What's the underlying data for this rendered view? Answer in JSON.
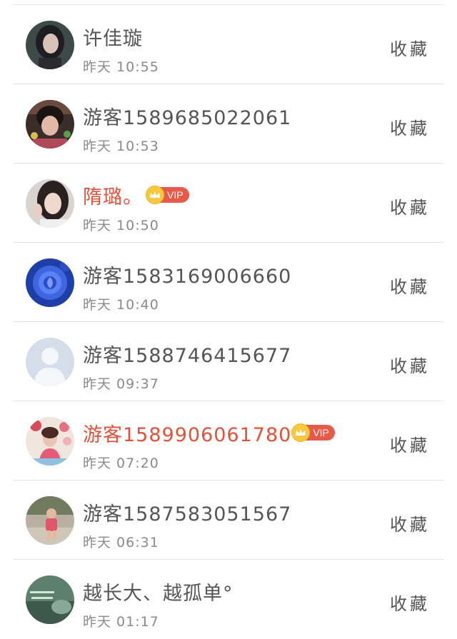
{
  "favorite_label": "收藏",
  "vip_label": "VIP",
  "items": [
    {
      "name": "许佳璇",
      "time": "昨天 10:55",
      "vip": false,
      "avatar": "woman-dark-hair-avatar"
    },
    {
      "name": "游客1589685022061",
      "time": "昨天 10:53",
      "vip": false,
      "avatar": "woman-portrait-avatar"
    },
    {
      "name": "隋璐。",
      "time": "昨天 10:50",
      "vip": true,
      "avatar": "woman-selfie-avatar"
    },
    {
      "name": "游客1583169006660",
      "time": "昨天 10:40",
      "vip": false,
      "avatar": "blue-rose-avatar"
    },
    {
      "name": "游客1588746415677",
      "time": "昨天 09:37",
      "vip": false,
      "avatar": "default-user-avatar"
    },
    {
      "name": "游客1589906061780",
      "time": "昨天 07:20",
      "vip": true,
      "avatar": "woman-flowers-avatar"
    },
    {
      "name": "游客1587583051567",
      "time": "昨天 06:31",
      "vip": false,
      "avatar": "child-outdoor-avatar"
    },
    {
      "name": "越长大、越孤单°",
      "time": "昨天 01:17",
      "vip": false,
      "avatar": "text-image-avatar"
    }
  ],
  "colors": {
    "vip_name": "#e0533a",
    "vip_badge": "#e65a4a",
    "crown": "#f5c842",
    "divider": "#e3e3e3"
  }
}
